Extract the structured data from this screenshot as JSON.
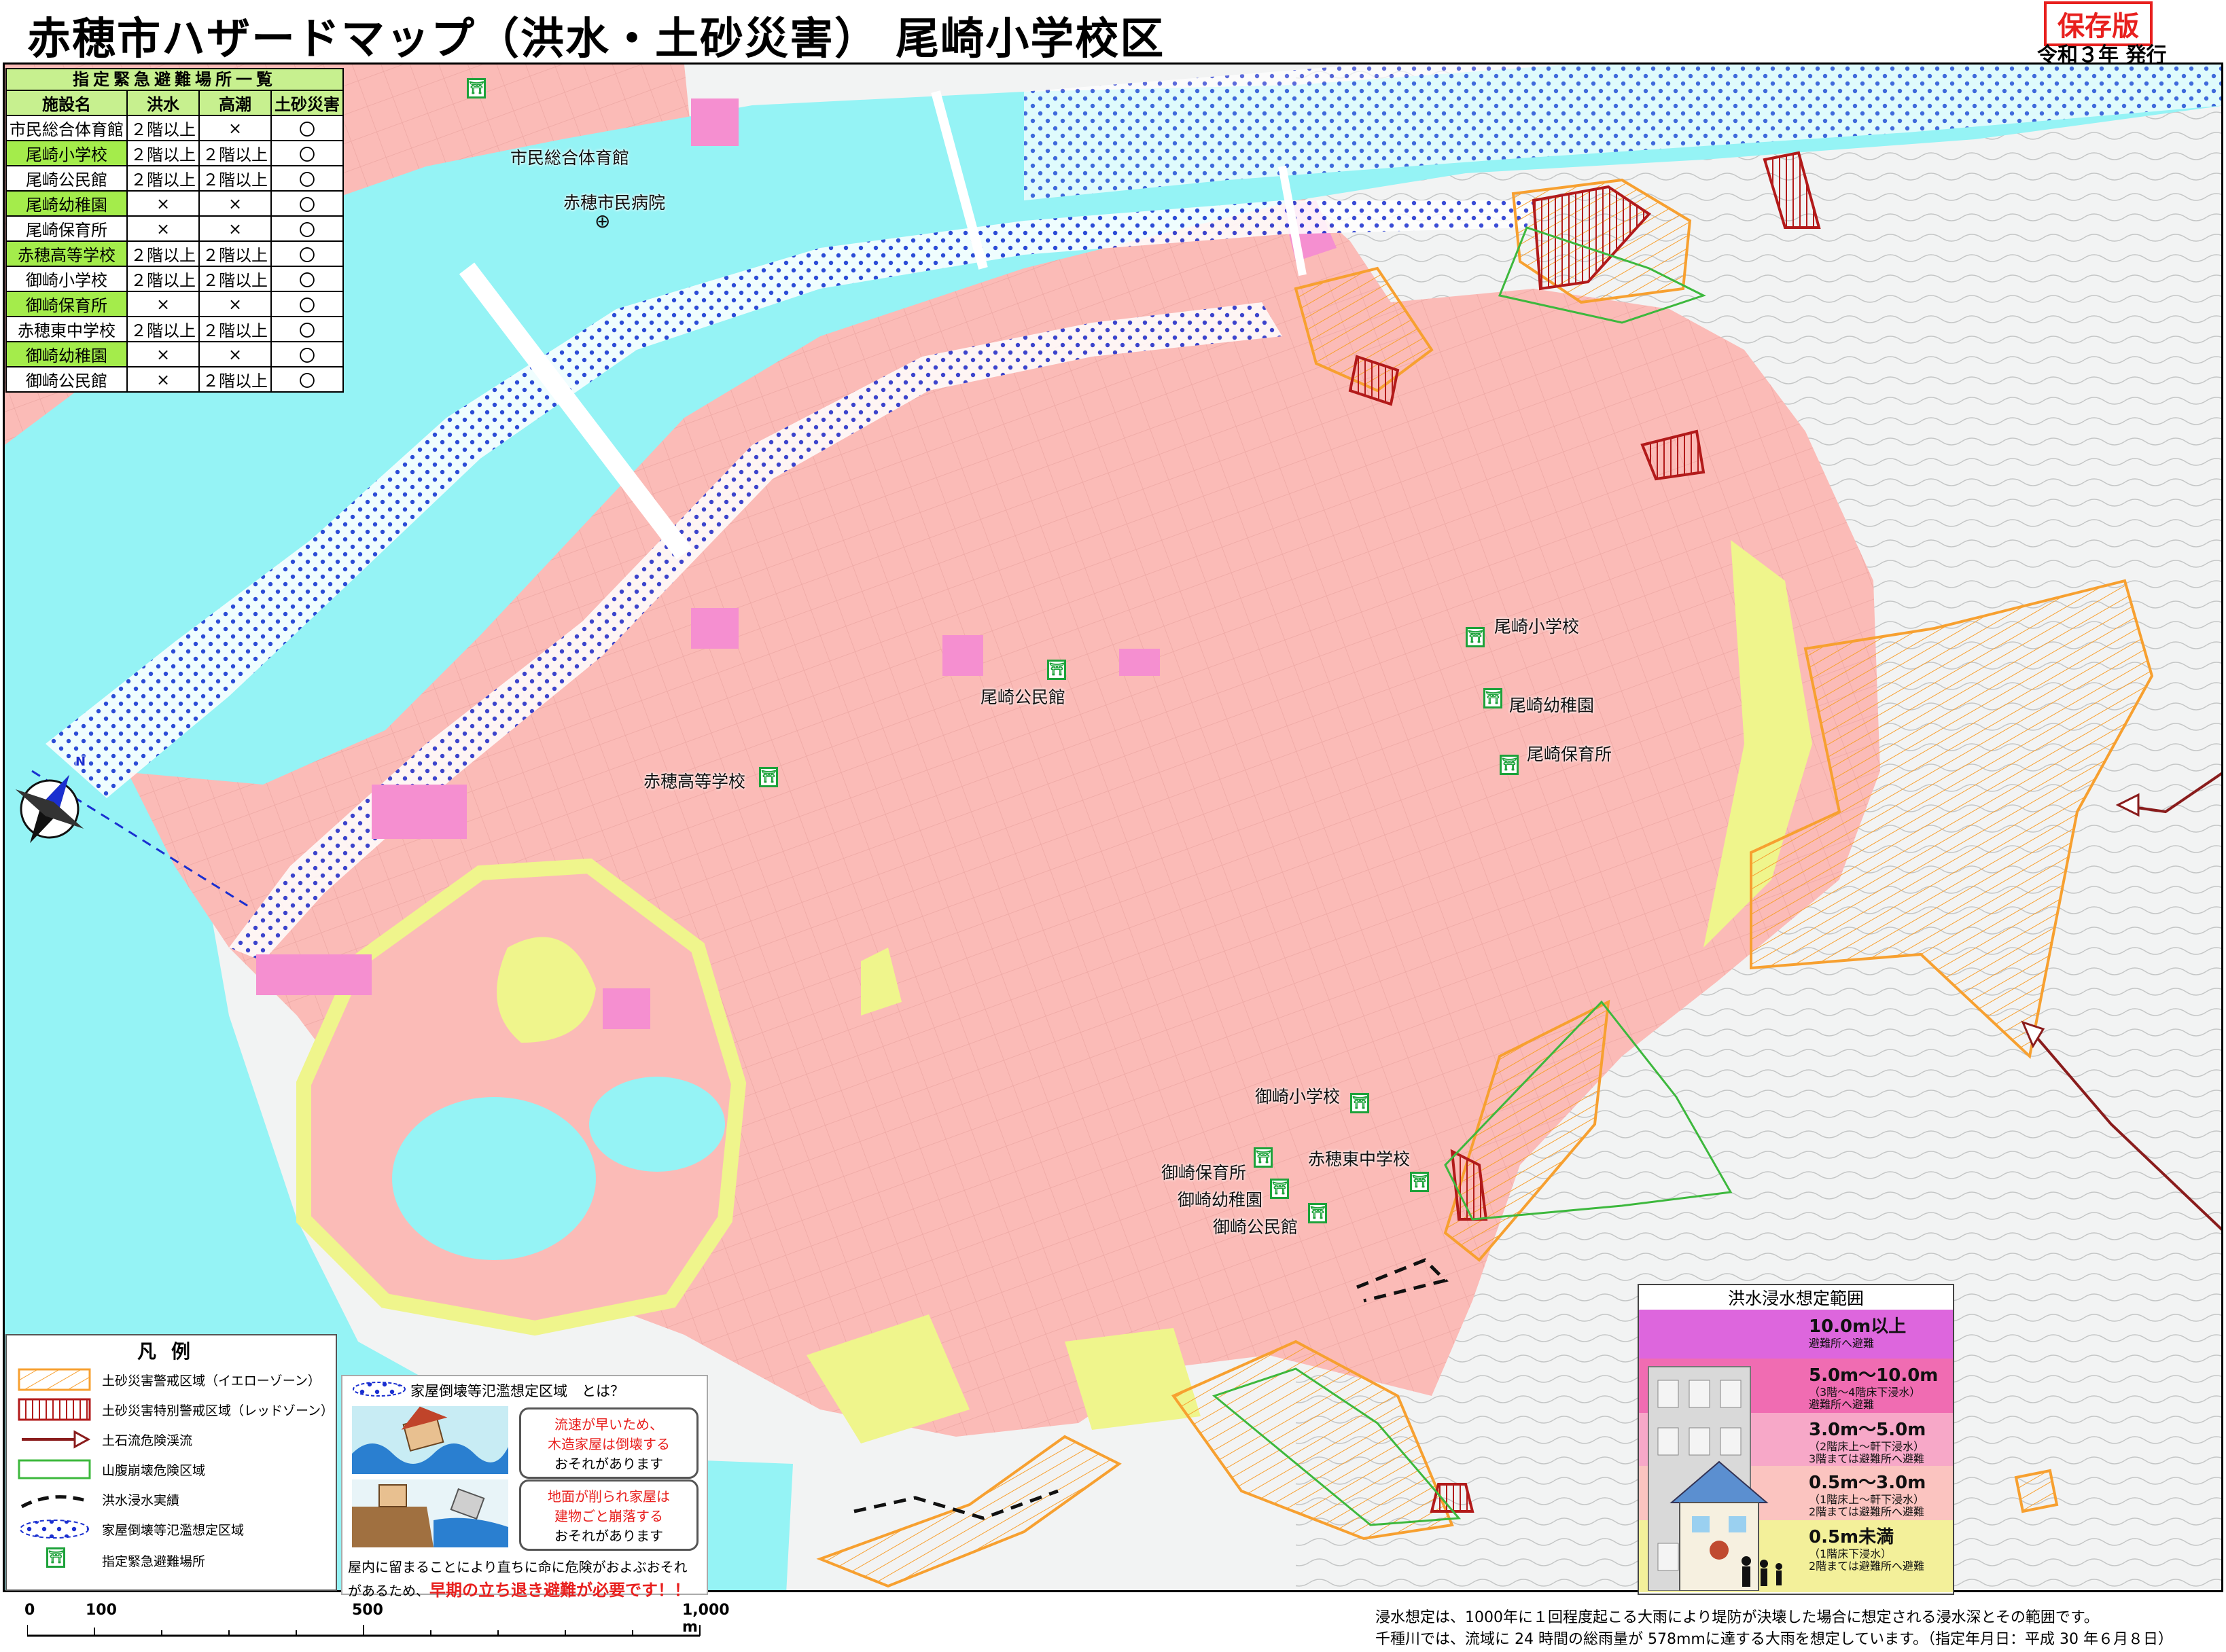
{
  "title": "赤穂市ハザードマップ（洪水・土砂災害） 尾崎小学校区",
  "stamp": "保存版",
  "issued": "令和３年 発行",
  "colors": {
    "sea": "#95f3f5",
    "flood_pink": "#fbbbb7",
    "deep_pink": "#f58fd0",
    "yellow_green": "#eff58c",
    "hazard_orange": "#f7a030",
    "hazard_red": "#b21a1a",
    "green_line": "#3db83d",
    "blue_dots": "#1a2fd0",
    "refuge_green": "#1da23a"
  },
  "shelter_table": {
    "caption": "指定緊急避難場所一覧",
    "headers": [
      "施設名",
      "洪水",
      "高潮",
      "土砂災害"
    ],
    "rows": [
      [
        "市民総合体育館",
        "２階以上",
        "×",
        "〇"
      ],
      [
        "尾崎小学校",
        "２階以上",
        "２階以上",
        "〇"
      ],
      [
        "尾崎公民館",
        "２階以上",
        "２階以上",
        "〇"
      ],
      [
        "尾崎幼稚園",
        "×",
        "×",
        "〇"
      ],
      [
        "尾崎保育所",
        "×",
        "×",
        "〇"
      ],
      [
        "赤穂高等学校",
        "２階以上",
        "２階以上",
        "〇"
      ],
      [
        "御崎小学校",
        "２階以上",
        "２階以上",
        "〇"
      ],
      [
        "御崎保育所",
        "×",
        "×",
        "〇"
      ],
      [
        "赤穂東中学校",
        "２階以上",
        "２階以上",
        "〇"
      ],
      [
        "御崎幼稚園",
        "×",
        "×",
        "〇"
      ],
      [
        "御崎公民館",
        "×",
        "２階以上",
        "〇"
      ]
    ]
  },
  "map_labels": {
    "gym": "市民総合体育館",
    "hospital": "赤穂市民病院",
    "ozaki_elem": "尾崎小学校",
    "ozaki_kinder": "尾崎幼稚園",
    "ozaki_nursery": "尾崎保育所",
    "ozaki_hall": "尾崎公民館",
    "ako_high": "赤穂高等学校",
    "misaki_elem": "御崎小学校",
    "misaki_nursery": "御崎保育所",
    "ako_east_jh": "赤穂東中学校",
    "misaki_kinder": "御崎幼稚園",
    "misaki_hall": "御崎公民館",
    "compass_n": "N",
    "hospital_icon": "hospital-cross-icon"
  },
  "legend": {
    "title": "凡例",
    "items": [
      "土砂災害警戒区域（イエローゾーン）",
      "土砂災害特別警戒区域（レッドゾーン）",
      "土石流危険渓流",
      "山腹崩壊危険区域",
      "洪水浸水実績",
      "家屋倒壊等氾濫想定区域",
      "指定緊急避難場所"
    ]
  },
  "house_collapse": {
    "title": "家屋倒壊等氾濫想定区域　とは？",
    "bubble1": [
      "流速が早いため、",
      "木造家屋は倒壊する",
      "おそれがあります"
    ],
    "bubble2": [
      "地面が削られ家屋は",
      "建物ごと崩落する",
      "おそれがあります"
    ],
    "note1": "屋内に留まることにより直ちに命に危険がおよぶおそれ",
    "note2": "があるため、",
    "urge": "早期の立ち退き避難が必要です！！"
  },
  "depth_legend": {
    "title": "洪水浸水想定範囲",
    "bands": [
      {
        "label": "10.0m以上",
        "sub1": "避難所へ避難",
        "sub2": "",
        "color": "#dd66dd"
      },
      {
        "label": "5.0m〜10.0m",
        "sub1": "（3階〜4階床下浸水）",
        "sub2": "避難所へ避難",
        "color": "#f06cb2"
      },
      {
        "label": "3.0m〜5.0m",
        "sub1": "（2階床上〜軒下浸水）",
        "sub2": "3階まては避難所へ避難",
        "color": "#f7a8c8"
      },
      {
        "label": "0.5m〜3.0m",
        "sub1": "（1階床上〜軒下浸水）",
        "sub2": "2階まては避難所へ避難",
        "color": "#fbc4c0"
      },
      {
        "label": "0.5m未満",
        "sub1": "（1階床下浸水）",
        "sub2": "2階まては避難所へ避難",
        "color": "#f3f09a"
      }
    ]
  },
  "scale": {
    "labels": [
      "0",
      "100",
      "500",
      "1,000 m"
    ],
    "values_m": [
      0,
      100,
      500,
      1000
    ]
  },
  "footnote": [
    "浸水想定は、1000年に１回程度起こる大雨により堤防が決壊した場合に想定される浸水深とその範囲です。",
    "千種川では、流域に 24 時間の総雨量が 578mmに達する大雨を想定しています。（指定年月日：平成 30 年６月８日）"
  ]
}
